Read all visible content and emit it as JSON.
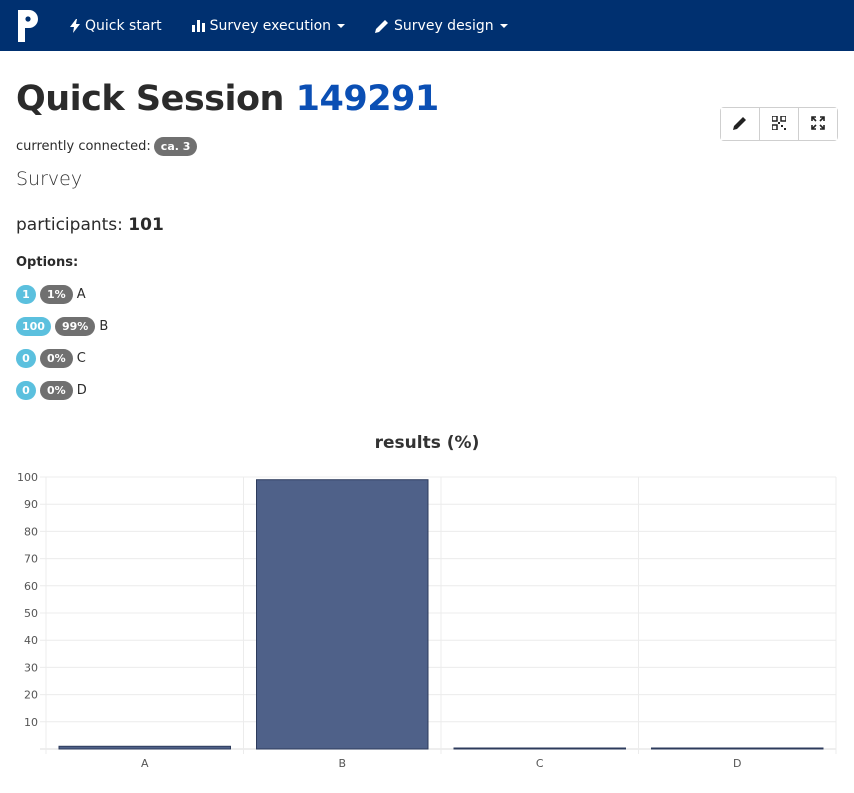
{
  "navbar": {
    "items": [
      {
        "label": "Quick start",
        "icon": "bolt-icon"
      },
      {
        "label": "Survey execution",
        "icon": "bar-chart-icon",
        "dropdown": true
      },
      {
        "label": "Survey design",
        "icon": "pencil-icon",
        "dropdown": true
      }
    ]
  },
  "header": {
    "title": "Quick Session",
    "session_id": "149291",
    "connected_label": "currently connected:",
    "connected_count": "ca. 3"
  },
  "survey": {
    "type_label": "Survey",
    "participants_label": "participants:",
    "participants_count": "101",
    "options_label": "Options:",
    "options": [
      {
        "count": "1",
        "percent": "1%",
        "label": "A"
      },
      {
        "count": "100",
        "percent": "99%",
        "label": "B"
      },
      {
        "count": "0",
        "percent": "0%",
        "label": "C"
      },
      {
        "count": "0",
        "percent": "0%",
        "label": "D"
      }
    ]
  },
  "chart_data": {
    "type": "bar",
    "title": "results (%)",
    "categories": [
      "A",
      "B",
      "C",
      "D"
    ],
    "values": [
      1,
      99,
      0,
      0
    ],
    "ylim": [
      0,
      100
    ],
    "yticks": [
      10,
      20,
      30,
      40,
      50,
      60,
      70,
      80,
      90,
      100
    ],
    "grid": true,
    "bar_color": "#4f6189"
  }
}
